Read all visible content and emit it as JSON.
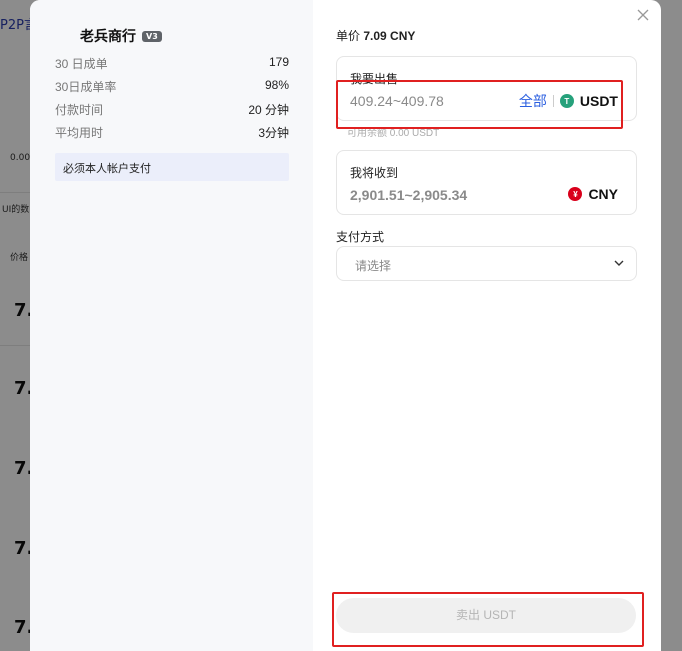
{
  "background": {
    "title": "P2P言",
    "snippets": [
      "0.00",
      "UI的数",
      "价格"
    ],
    "prices": [
      "7.",
      "7.",
      "7.",
      "7.",
      "7."
    ]
  },
  "merchant": {
    "name": "老兵商行",
    "badge": "V3"
  },
  "stats": [
    {
      "label": "30 日成单",
      "value": "179"
    },
    {
      "label": "30日成单率",
      "value": "98%"
    },
    {
      "label": "付款时间",
      "value": "20 分钟"
    },
    {
      "label": "平均用时",
      "value": "3分钟"
    }
  ],
  "requirement": "必须本人帐户支付",
  "unit_price": {
    "label": "单价",
    "value": "7.09 CNY"
  },
  "sell": {
    "label": "我要出售",
    "value": "409.24~409.78",
    "all_label": "全部",
    "currency": "USDT",
    "balance": "可用余额 0.00 USDT"
  },
  "receive": {
    "label": "我将收到",
    "value": "2,901.51~2,905.34",
    "currency": "CNY"
  },
  "payment": {
    "label": "支付方式",
    "placeholder": "请选择"
  },
  "submit_label": "卖出 USDT",
  "icons": {
    "usdt": "tether-icon",
    "cny": "yuan-icon",
    "close": "close-icon",
    "chevron": "chevron-down-icon"
  },
  "colors": {
    "accent": "#2b5fe0",
    "usdt": "#26a17b",
    "cny": "#d9001b",
    "highlight": "#e02020"
  }
}
